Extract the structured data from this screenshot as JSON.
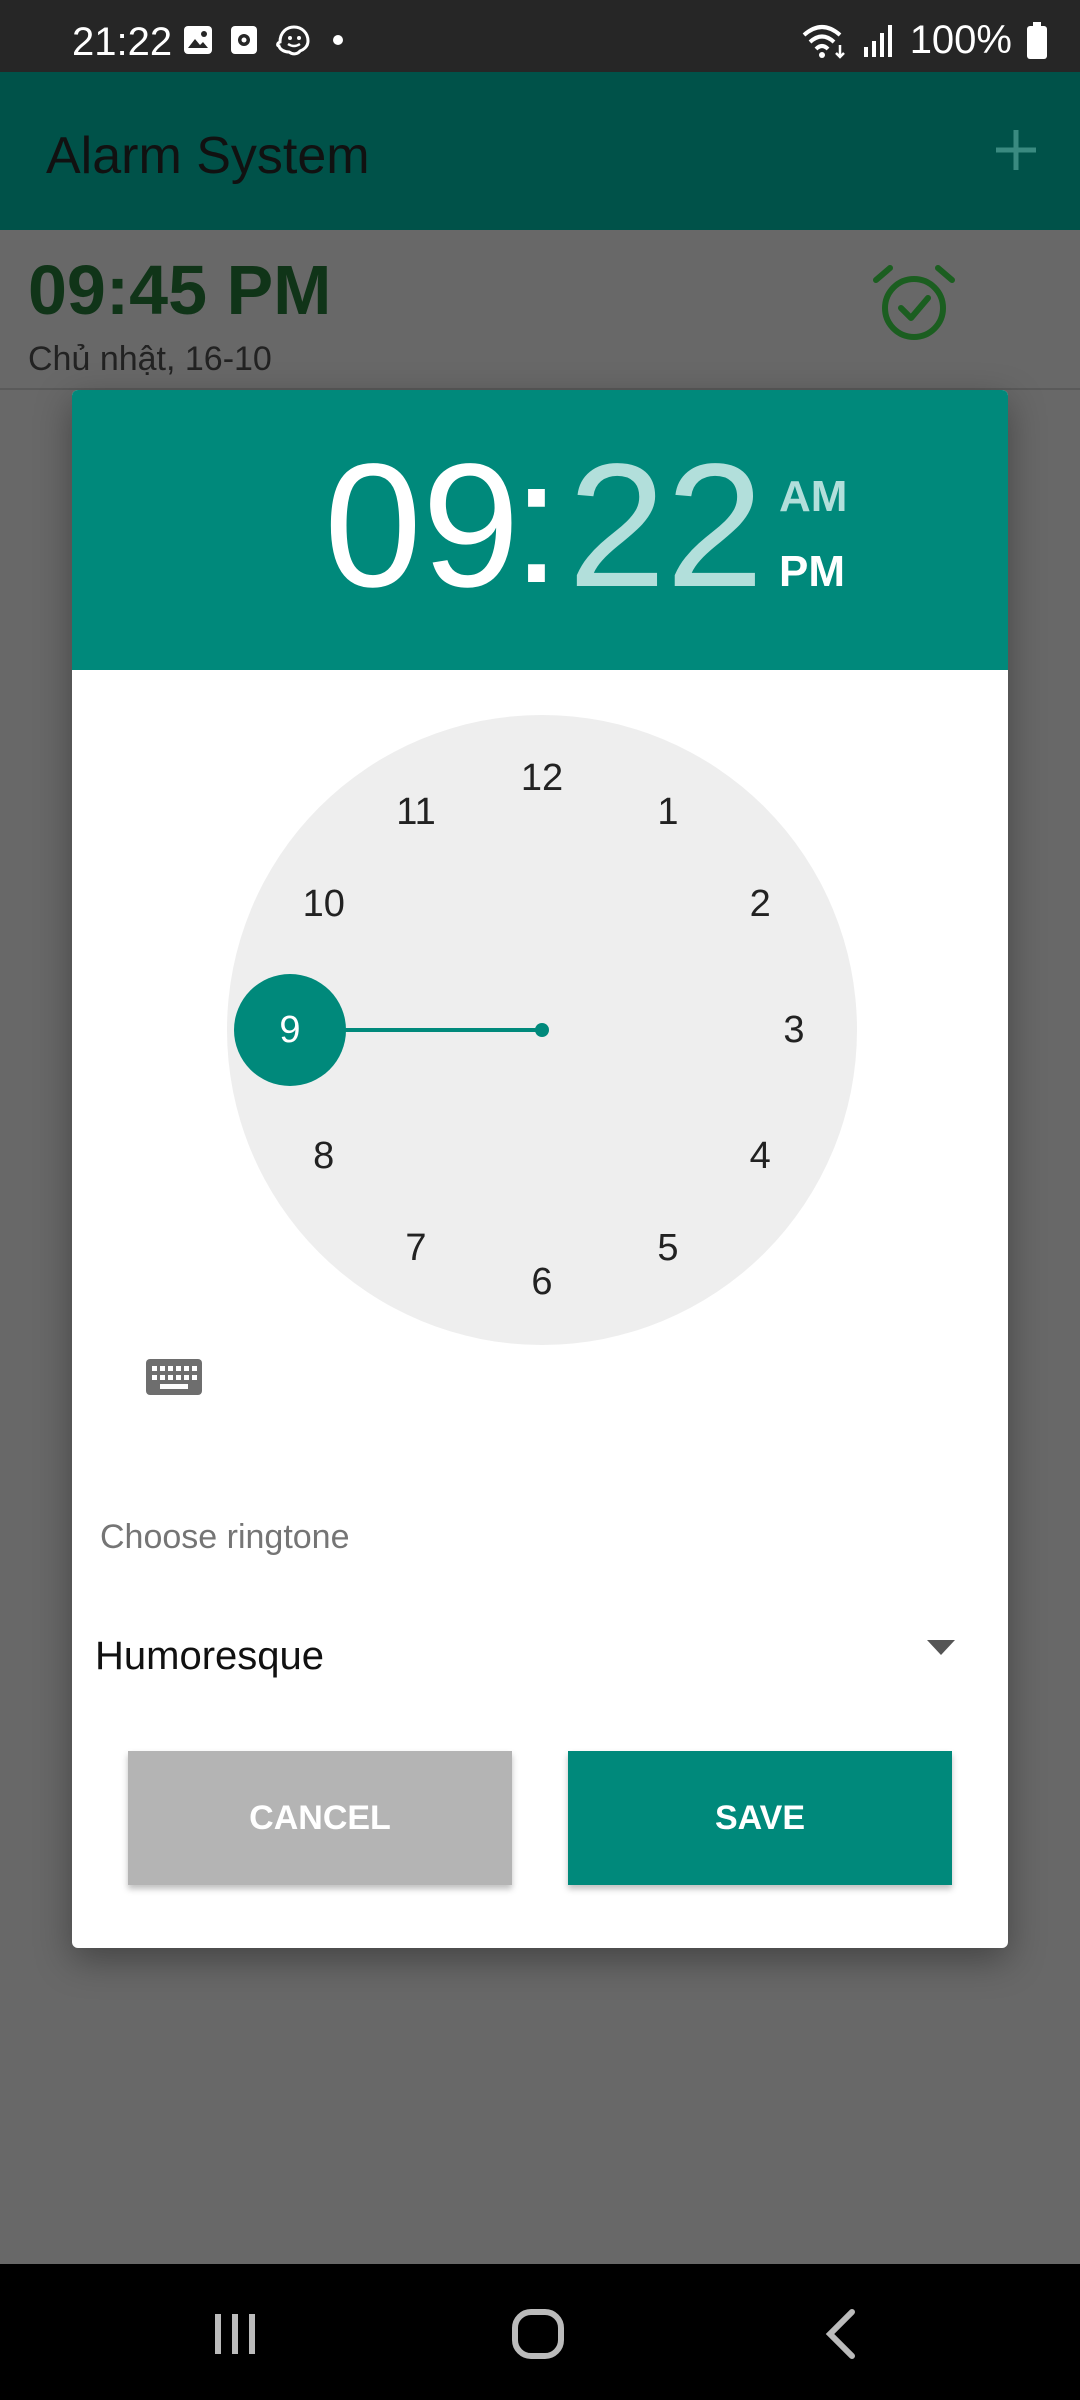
{
  "status_bar": {
    "time": "21:22",
    "battery": "100%"
  },
  "app_bar": {
    "title": "Alarm System"
  },
  "alarm_item": {
    "time": "09:45 PM",
    "date": "Chủ nhật, 16-10"
  },
  "dialog": {
    "hour": "09",
    "separator": ":",
    "minute": "22",
    "am_label": "AM",
    "pm_label": "PM",
    "selected_period": "PM",
    "clock_numbers": [
      "12",
      "1",
      "2",
      "3",
      "4",
      "5",
      "6",
      "7",
      "8",
      "9",
      "10",
      "11"
    ],
    "selected_number": "9",
    "ringtone_label": "Choose ringtone",
    "ringtone_value": "Humoresque",
    "cancel_label": "CANCEL",
    "save_label": "SAVE"
  },
  "colors": {
    "accent": "#00897b",
    "app_bar": "#005249",
    "unselected_time": "#b2dfdb",
    "alarm_icon": "#1b5e20"
  },
  "icons": [
    "image-icon",
    "screenshot-icon",
    "waze-icon",
    "dot-icon",
    "wifi-icon",
    "signal-icon",
    "battery-icon",
    "plus-icon",
    "alarm-check-icon",
    "keyboard-icon",
    "dropdown-arrow-icon",
    "recents-icon",
    "home-icon",
    "back-icon"
  ]
}
